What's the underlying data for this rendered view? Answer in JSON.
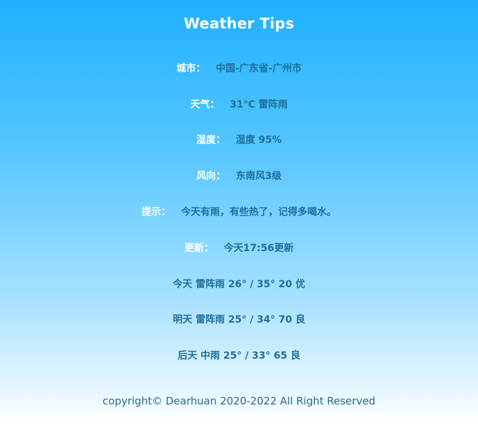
{
  "page": {
    "title": "Weather Tips"
  },
  "info": {
    "city_label": "城市：",
    "city_value": "中国-广东省-广州市",
    "weather_label": "天气：",
    "weather_value": "31℃ 雷阵雨",
    "humidity_label": "湿度：",
    "humidity_value": "湿度 95%",
    "wind_label": "风向：",
    "wind_value": "东南风3级",
    "tip_label": "提示：",
    "tip_value": "今天有雨，有些热了，记得多喝水。",
    "update_label": "更新：",
    "update_value": "今天17:56更新"
  },
  "forecast": [
    "今天 雷阵雨 26° / 35° 20 优",
    "明天 雷阵雨 25° / 34° 70 良",
    "后天 中雨 25° / 33° 65 良"
  ],
  "footer": {
    "copyright": "copyright© Dearhuan 2020-2022 All Right Reserved"
  },
  "colors": {
    "gradient_top": "#1fb0ff",
    "gradient_bottom": "#ffffff",
    "label_color": "#ffffff",
    "value_color": "#1f6f9a"
  }
}
